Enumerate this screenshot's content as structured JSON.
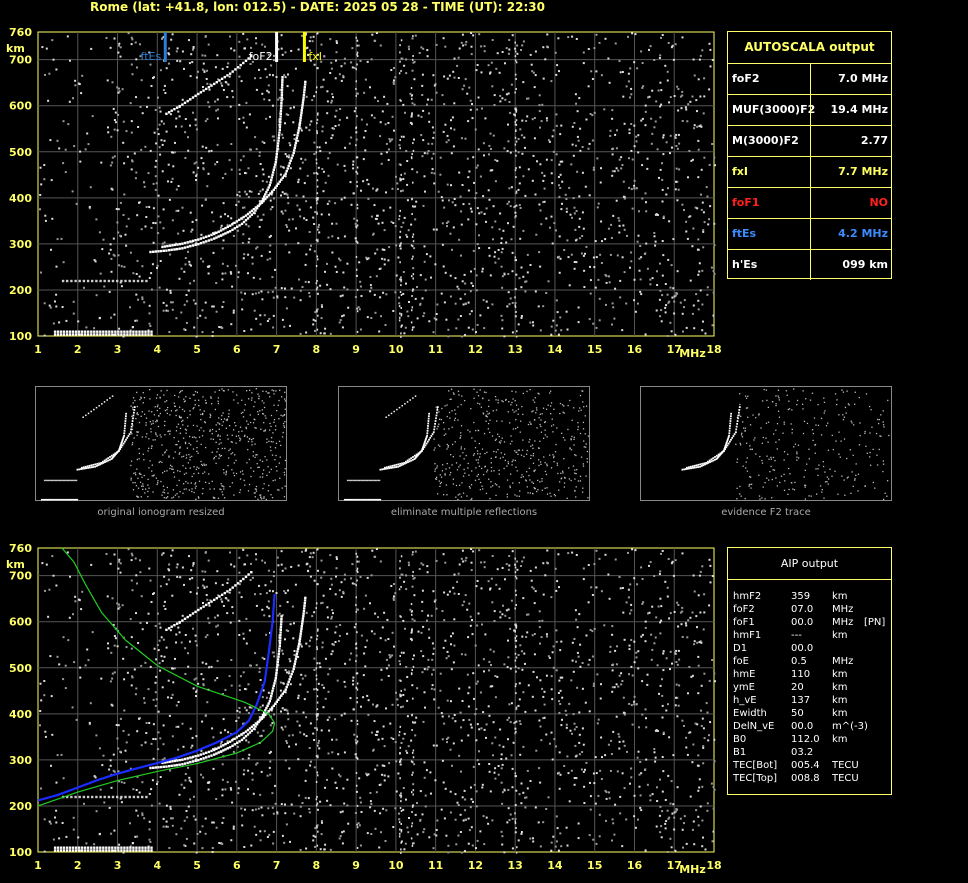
{
  "header": {
    "text": "Rome (lat: +41.8, lon: 012.5) - DATE: 2025 05 28 - TIME (UT): 22:30"
  },
  "colors": {
    "axes": "#ffff66",
    "grid": "#555555",
    "trace": "#ffffff",
    "noise": "#9a9a9a",
    "ftEs": "#2e7fd8",
    "foF2": "#ffffff",
    "fxI": "#ffff00",
    "foF1": "#ff2020",
    "aip_profile": "#1a2cff",
    "aip_model": "#22cc22"
  },
  "chart_data": [
    {
      "type": "scatter",
      "name": "ionogram-autoscala",
      "y_unit_label": "km",
      "x_unit_label": "MHz",
      "xlim": [
        1,
        18
      ],
      "ylim": [
        100,
        760
      ],
      "xticks": [
        1,
        2,
        3,
        4,
        5,
        6,
        7,
        8,
        9,
        10,
        11,
        12,
        13,
        14,
        15,
        16,
        17,
        18
      ],
      "yticks": [
        100,
        200,
        300,
        400,
        500,
        600,
        700,
        760
      ],
      "grid": true,
      "markers": [
        {
          "label": "ftEs",
          "x": 4.2,
          "color": "#2e7fd8"
        },
        {
          "label": "foF2",
          "x": 7.0,
          "color": "#ffffff"
        },
        {
          "label": "fxI",
          "x": 7.7,
          "color": "#ffff00"
        }
      ],
      "traces": {
        "o_F2": [
          [
            3.8,
            285
          ],
          [
            4.2,
            288
          ],
          [
            4.6,
            293
          ],
          [
            5.0,
            302
          ],
          [
            5.4,
            314
          ],
          [
            5.8,
            330
          ],
          [
            6.1,
            346
          ],
          [
            6.4,
            370
          ],
          [
            6.6,
            395
          ],
          [
            6.8,
            430
          ],
          [
            6.95,
            480
          ],
          [
            7.05,
            550
          ],
          [
            7.1,
            620
          ],
          [
            7.12,
            670
          ]
        ],
        "x_F2": [
          [
            4.1,
            296
          ],
          [
            4.6,
            303
          ],
          [
            5.0,
            312
          ],
          [
            5.4,
            324
          ],
          [
            5.8,
            342
          ],
          [
            6.2,
            364
          ],
          [
            6.6,
            392
          ],
          [
            6.9,
            420
          ],
          [
            7.2,
            455
          ],
          [
            7.4,
            500
          ],
          [
            7.55,
            560
          ],
          [
            7.65,
            620
          ],
          [
            7.7,
            660
          ]
        ],
        "Es": [
          [
            1.4,
            112
          ],
          [
            3.9,
            112
          ],
          [
            1.6,
            222
          ],
          [
            3.8,
            222
          ]
        ],
        "multi_hop": [
          [
            4.2,
            585
          ],
          [
            4.6,
            605
          ],
          [
            5.0,
            628
          ],
          [
            5.4,
            650
          ],
          [
            5.8,
            672
          ],
          [
            6.2,
            700
          ],
          [
            6.4,
            715
          ]
        ]
      }
    },
    {
      "type": "scatter",
      "name": "ionogram-aip",
      "y_unit_label": "km",
      "x_unit_label": "MHz",
      "xlim": [
        1,
        18
      ],
      "ylim": [
        100,
        760
      ],
      "xticks": [
        1,
        2,
        3,
        4,
        5,
        6,
        7,
        8,
        9,
        10,
        11,
        12,
        13,
        14,
        15,
        16,
        17,
        18
      ],
      "yticks": [
        100,
        200,
        300,
        400,
        500,
        600,
        700,
        760
      ],
      "grid": true,
      "profile_blue": [
        [
          1.0,
          212
        ],
        [
          1.5,
          224
        ],
        [
          2.0,
          240
        ],
        [
          2.5,
          256
        ],
        [
          3.0,
          270
        ],
        [
          3.5,
          282
        ],
        [
          4.0,
          293
        ],
        [
          4.5,
          305
        ],
        [
          5.0,
          320
        ],
        [
          5.5,
          338
        ],
        [
          6.0,
          360
        ],
        [
          6.3,
          385
        ],
        [
          6.5,
          420
        ],
        [
          6.7,
          470
        ],
        [
          6.8,
          530
        ],
        [
          6.9,
          600
        ],
        [
          6.95,
          660
        ]
      ],
      "model_green": [
        [
          1.0,
          200
        ],
        [
          2.0,
          230
        ],
        [
          3.0,
          255
        ],
        [
          4.0,
          275
        ],
        [
          5.0,
          292
        ],
        [
          6.0,
          315
        ],
        [
          6.6,
          338
        ],
        [
          6.9,
          362
        ],
        [
          6.95,
          380
        ],
        [
          6.8,
          400
        ],
        [
          6.2,
          425
        ],
        [
          5.0,
          460
        ],
        [
          4.0,
          505
        ],
        [
          3.2,
          560
        ],
        [
          2.6,
          620
        ],
        [
          2.2,
          680
        ],
        [
          1.9,
          730
        ],
        [
          1.6,
          760
        ]
      ]
    }
  ],
  "autoscala": {
    "title": "AUTOSCALA output",
    "rows": [
      {
        "k": "foF2",
        "v": "7.0 MHz",
        "color": "#ffffff"
      },
      {
        "k": "MUF(3000)F2",
        "v": "19.4 MHz",
        "color": "#ffffff"
      },
      {
        "k": "M(3000)F2",
        "v": "2.77",
        "color": "#ffffff"
      },
      {
        "k": "fxI",
        "v": "7.7 MHz",
        "color": "#ffff66"
      },
      {
        "k": "foF1",
        "v": "NO",
        "color": "#ff2020"
      },
      {
        "k": "ftEs",
        "v": "4.2 MHz",
        "color": "#3a8cff"
      },
      {
        "k": "h'Es",
        "v": "099     km",
        "color": "#ffffff"
      }
    ]
  },
  "thumbnails": [
    {
      "caption": "original ionogram resized"
    },
    {
      "caption": "eliminate multiple reflections"
    },
    {
      "caption": "evidence F2 trace"
    }
  ],
  "aip": {
    "title": "AIP output",
    "rows": [
      {
        "k": "hmF2",
        "v": "359",
        "u": "km",
        "x": ""
      },
      {
        "k": "foF2",
        "v": "07.0",
        "u": "MHz",
        "x": ""
      },
      {
        "k": "foF1",
        "v": "00.0",
        "u": "MHz",
        "x": "[PN]"
      },
      {
        "k": "hmF1",
        "v": "---",
        "u": "km",
        "x": ""
      },
      {
        "k": "D1",
        "v": "00.0",
        "u": "",
        "x": ""
      },
      {
        "k": "foE",
        "v": "0.5",
        "u": "MHz",
        "x": ""
      },
      {
        "k": "hmE",
        "v": "110",
        "u": "km",
        "x": ""
      },
      {
        "k": "ymE",
        "v": "20",
        "u": "km",
        "x": ""
      },
      {
        "k": "h_vE",
        "v": "137",
        "u": "km",
        "x": ""
      },
      {
        "k": "Ewidth",
        "v": "50",
        "u": "km",
        "x": ""
      },
      {
        "k": "DelN_vE",
        "v": "00.0",
        "u": "m^(-3)",
        "x": ""
      },
      {
        "k": "B0",
        "v": "112.0",
        "u": "km",
        "x": ""
      },
      {
        "k": "B1",
        "v": "03.2",
        "u": "",
        "x": ""
      },
      {
        "k": "TEC[Bot]",
        "v": "005.4",
        "u": "TECU",
        "x": ""
      },
      {
        "k": "TEC[Top]",
        "v": "008.8",
        "u": "TECU",
        "x": ""
      }
    ]
  }
}
